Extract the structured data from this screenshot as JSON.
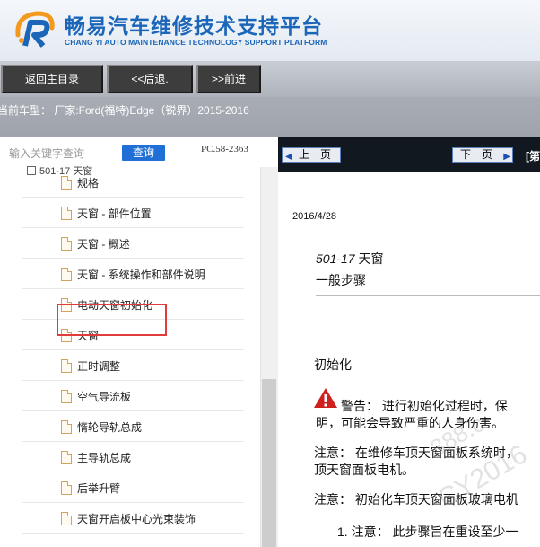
{
  "header": {
    "title": "畅易汽车维修技术支持平台",
    "subtitle": "CHANG YI AUTO MAINTENANCE TECHNOLOGY SUPPORT PLATFORM"
  },
  "toolbar": {
    "home_label": "返回主目录",
    "back_label": "<<后退.",
    "forward_label": ">>前进"
  },
  "vehicle": {
    "text": "当前车型： 厂家:Ford(福特)Edge（锐界）2015-2016"
  },
  "sidebar": {
    "search_placeholder": "输入关键字查询",
    "search_button": "查询",
    "pc_code": "PC.58-2363",
    "parent_label": "501-17 天窗",
    "items": [
      {
        "label": "规格"
      },
      {
        "label": "天窗 - 部件位置"
      },
      {
        "label": "天窗 - 概述"
      },
      {
        "label": "天窗 - 系统操作和部件说明"
      },
      {
        "label": "电动天窗初始化"
      },
      {
        "label": "天窗"
      },
      {
        "label": "正时调整"
      },
      {
        "label": "空气导流板"
      },
      {
        "label": "惰轮导轨总成"
      },
      {
        "label": "主导轨总成"
      },
      {
        "label": "后举升臂"
      },
      {
        "label": "天窗开启板中心光束装饰"
      }
    ]
  },
  "content": {
    "prev_label": "上一页",
    "next_label": "下一页",
    "top_tail": "[第",
    "date": "2016/4/28",
    "section_code": "501-17",
    "section_name": " 天窗",
    "subsection": "一般步骤",
    "heading": "初始化",
    "warning_line1": "警告： 进行初始化过程时，保",
    "warning_line2": "明，可能会导致严重的人身伤害。",
    "note1_line1": "注意： 在维修车顶天窗面板系统时，",
    "note1_line2": "顶天窗面板电机。",
    "note2": "注意： 初始化车顶天窗面板玻璃电机",
    "step1": "1.  注意： 此步骤旨在重设至少一",
    "watermark_1": "388.c",
    "watermark_2": "CY2016"
  },
  "colors": {
    "brand_blue": "#1b66b8",
    "toolbar_button": "#3d3d3d",
    "search_button": "#1f6fd6",
    "highlight": "#e03c3c",
    "content_top": "#111820"
  }
}
